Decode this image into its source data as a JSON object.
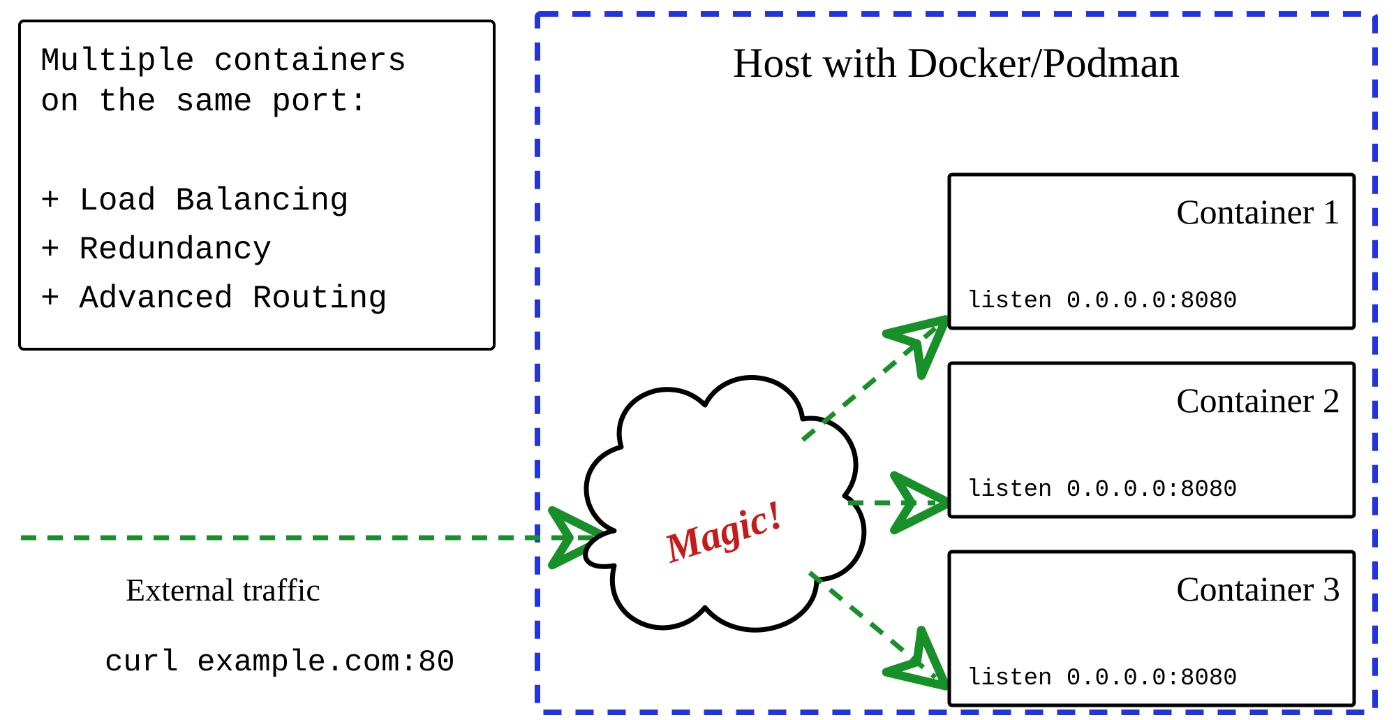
{
  "infoBox": {
    "heading1": "Multiple containers",
    "heading2": "on the same port:",
    "bullet1": "+ Load Balancing",
    "bullet2": "+ Redundancy",
    "bullet3": "+ Advanced Routing"
  },
  "external": {
    "label": "External traffic",
    "command": "curl example.com:80"
  },
  "host": {
    "title": "Host with Docker/Podman"
  },
  "magic": {
    "label": "Magic!"
  },
  "containers": [
    {
      "title": "Container 1",
      "listen": "listen 0.0.0.0:8080"
    },
    {
      "title": "Container 2",
      "listen": "listen 0.0.0.0:8080"
    },
    {
      "title": "Container 3",
      "listen": "listen 0.0.0.0:8080"
    }
  ],
  "colors": {
    "hostBorder": "#2234e0",
    "arrowGreen": "#17902a",
    "magicRed": "#c71a1a",
    "black": "#000000"
  }
}
